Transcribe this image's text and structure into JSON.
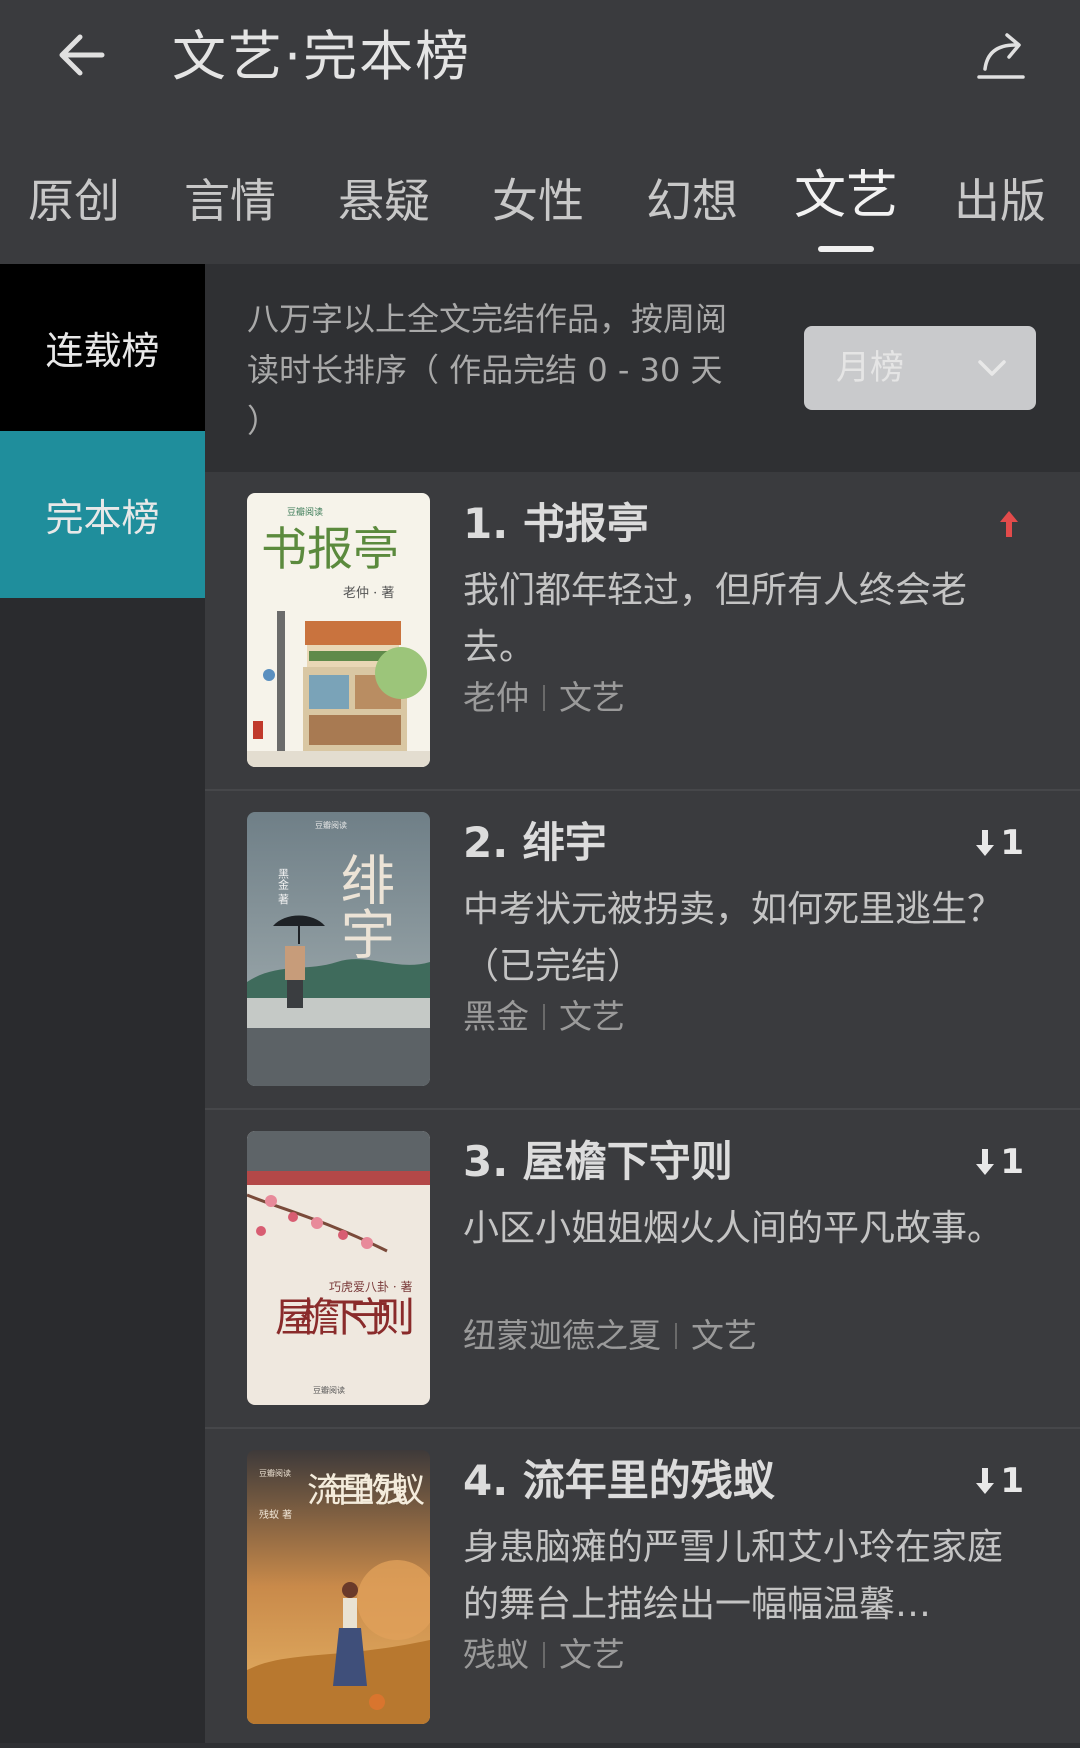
{
  "header": {
    "title": "文艺·完本榜",
    "back_icon": "arrow-left-icon",
    "share_icon": "share-icon"
  },
  "tabs": [
    {
      "label": "原创"
    },
    {
      "label": "言情"
    },
    {
      "label": "悬疑"
    },
    {
      "label": "女性"
    },
    {
      "label": "幻想"
    },
    {
      "label": "文艺",
      "active": true
    },
    {
      "label": "出版"
    }
  ],
  "sidebar": {
    "items": [
      {
        "label": "连载榜"
      },
      {
        "label": "完本榜",
        "active": true
      }
    ]
  },
  "description": "八万字以上全文完结作品，按周阅读时长排序（ 作品完结 0 - 30 天 ）",
  "period_select": {
    "selected": "月榜"
  },
  "colors": {
    "accent": "#1f8e9c",
    "trend_up": "#e24b4b"
  },
  "books": [
    {
      "title": "1. 书报亭",
      "trend": "up",
      "trend_text": "",
      "blurb": "我们都年轻过，但所有人终会老去。",
      "author": "老仲",
      "genre": "文艺",
      "cover_title": "书报亭",
      "cover_author": "老仲 · 著",
      "cover_logo": "豆瓣阅读"
    },
    {
      "title": "2. 绯宇",
      "trend": "down",
      "trend_text": "1",
      "blurb": "中考状元被拐卖，如何死里逃生？（已完结）",
      "author": "黑金",
      "genre": "文艺",
      "cover_title": "绯宇",
      "cover_author": "黑金 著",
      "cover_logo": "豆瓣阅读"
    },
    {
      "title": "3. 屋檐下守则",
      "trend": "down",
      "trend_text": "1",
      "blurb": "小区小姐姐烟火人间的平凡故事。",
      "author": "纽蒙迦德之夏",
      "genre": "文艺",
      "cover_title": "屋檐下守则",
      "cover_author": "巧虎爱八卦 · 著",
      "cover_logo": "豆瓣阅读"
    },
    {
      "title": "4. 流年里的残蚁",
      "trend": "down",
      "trend_text": "1",
      "blurb": "身患脑瘫的严雪儿和艾小玲在家庭的舞台上描绘出一幅幅温馨…",
      "author": "残蚁",
      "genre": "文艺",
      "cover_title": "流年里的残蚁",
      "cover_author": "残蚁 著",
      "cover_logo": "豆瓣阅读"
    }
  ]
}
